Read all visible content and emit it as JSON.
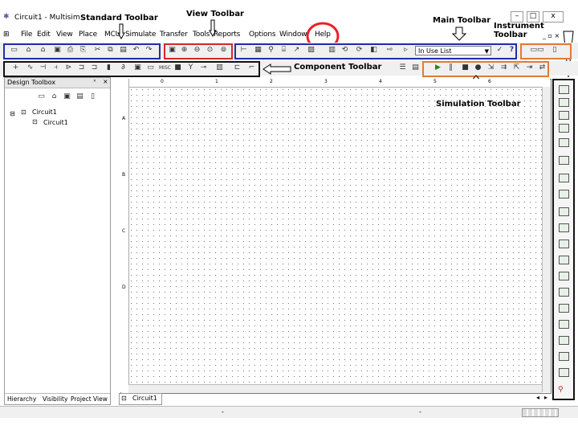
{
  "window": {
    "title": "Circuit1 - Multisim -",
    "controls": [
      "–",
      "□",
      "x"
    ]
  },
  "menu": [
    "File",
    "Edit",
    "View",
    "Place",
    "MCU",
    "Simulate",
    "Transfer",
    "Tools",
    "Reports",
    "Options",
    "Window",
    "Help"
  ],
  "annotations": {
    "standard": "Standard Toolbar",
    "view": "View Toolbar",
    "main": "Main Toolbar",
    "instrument": "Instrument Toolbar",
    "component": "Component Toolbar",
    "simulation": "Simulation Toolbar"
  },
  "toolbar": {
    "in_use_list": "In Use List",
    "help_icon": "?"
  },
  "design_toolbox": {
    "title": "Design Toolbox",
    "tree_root": "Circuit1",
    "tree_child": "Circuit1",
    "tabs": [
      "Hierarchy",
      "Visibility",
      "Project View"
    ]
  },
  "canvas": {
    "tab_label": "Circuit1",
    "ruler_top": [
      "0",
      "1",
      "2",
      "3",
      "4",
      "5",
      "6"
    ],
    "ruler_left": [
      "A",
      "B",
      "C",
      "D"
    ]
  },
  "colors": {
    "annotation_box_blue": "#1f2fa8",
    "annotation_box_red": "#d32a2a",
    "annotation_box_orange": "#e07b39",
    "annotation_box_black": "#111111",
    "help_circle": "#e8202a"
  }
}
